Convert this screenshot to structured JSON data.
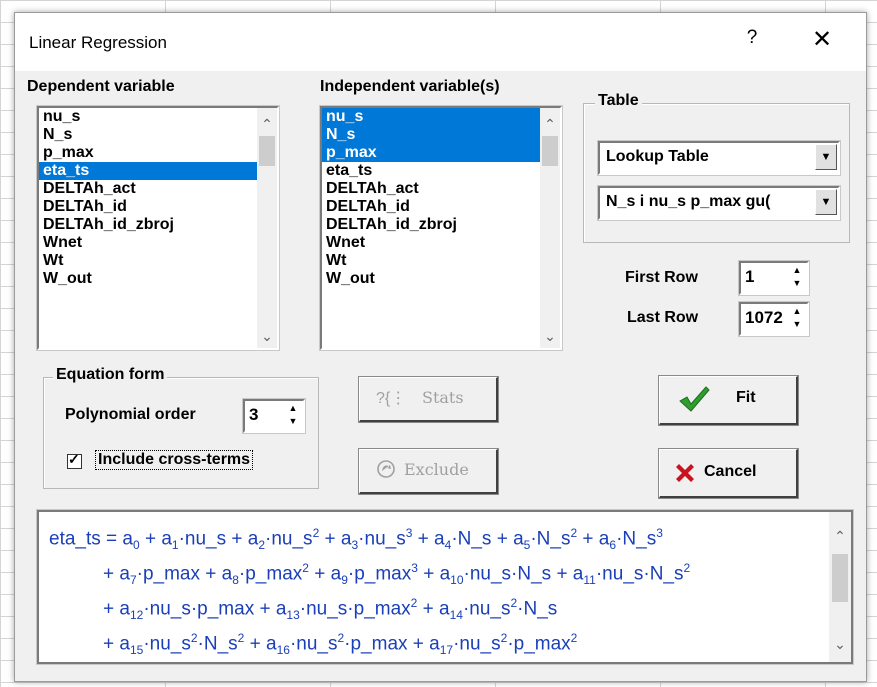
{
  "window": {
    "title": "Linear Regression",
    "help": "?",
    "close": "✕"
  },
  "dependent": {
    "label": "Dependent variable",
    "items": [
      "nu_s",
      "N_s",
      "p_max",
      "eta_ts",
      "DELTAh_act",
      "DELTAh_id",
      "DELTAh_id_zbroj",
      "Wnet",
      "Wt",
      "W_out"
    ],
    "selected": [
      3
    ]
  },
  "independent": {
    "label": "Independent variable(s)",
    "items": [
      "nu_s",
      "N_s",
      "p_max",
      "eta_ts",
      "DELTAh_act",
      "DELTAh_id",
      "DELTAh_id_zbroj",
      "Wnet",
      "Wt",
      "W_out"
    ],
    "selected": [
      0,
      1,
      2
    ]
  },
  "table": {
    "label": "Table",
    "type_value": "Lookup Table",
    "name_value": "N_s i nu_s p_max gu("
  },
  "rows": {
    "first_label": "First Row",
    "first_value": "1",
    "last_label": "Last Row",
    "last_value": "1072"
  },
  "equation_form": {
    "label": "Equation form",
    "poly_label": "Polynomial order",
    "poly_value": "3",
    "cross_label": "Include cross-terms",
    "cross_checked": true
  },
  "buttons": {
    "stats": "Stats",
    "exclude": "Exclude",
    "fit": "Fit",
    "cancel": "Cancel"
  },
  "equation": {
    "line1": [
      [
        "t",
        "eta_ts = a"
      ],
      [
        "sub",
        "0"
      ],
      [
        "t",
        " + a"
      ],
      [
        "sub",
        "1"
      ],
      [
        "t",
        "·nu_s + a"
      ],
      [
        "sub",
        "2"
      ],
      [
        "t",
        "·nu_s"
      ],
      [
        "sup",
        "2"
      ],
      [
        "t",
        " + a"
      ],
      [
        "sub",
        "3"
      ],
      [
        "t",
        "·nu_s"
      ],
      [
        "sup",
        "3"
      ],
      [
        "t",
        " + a"
      ],
      [
        "sub",
        "4"
      ],
      [
        "t",
        "·N_s + a"
      ],
      [
        "sub",
        "5"
      ],
      [
        "t",
        "·N_s"
      ],
      [
        "sup",
        "2"
      ],
      [
        "t",
        " + a"
      ],
      [
        "sub",
        "6"
      ],
      [
        "t",
        "·N_s"
      ],
      [
        "sup",
        "3"
      ]
    ],
    "line2": [
      [
        "t",
        "+ a"
      ],
      [
        "sub",
        "7"
      ],
      [
        "t",
        "·p_max + a"
      ],
      [
        "sub",
        "8"
      ],
      [
        "t",
        "·p_max"
      ],
      [
        "sup",
        "2"
      ],
      [
        "t",
        " + a"
      ],
      [
        "sub",
        "9"
      ],
      [
        "t",
        "·p_max"
      ],
      [
        "sup",
        "3"
      ],
      [
        "t",
        " + a"
      ],
      [
        "sub",
        "10"
      ],
      [
        "t",
        "·nu_s·N_s + a"
      ],
      [
        "sub",
        "11"
      ],
      [
        "t",
        "·nu_s·N_s"
      ],
      [
        "sup",
        "2"
      ]
    ],
    "line3": [
      [
        "t",
        "+ a"
      ],
      [
        "sub",
        "12"
      ],
      [
        "t",
        "·nu_s·p_max + a"
      ],
      [
        "sub",
        "13"
      ],
      [
        "t",
        "·nu_s·p_max"
      ],
      [
        "sup",
        "2"
      ],
      [
        "t",
        " + a"
      ],
      [
        "sub",
        "14"
      ],
      [
        "t",
        "·nu_s"
      ],
      [
        "sup",
        "2"
      ],
      [
        "t",
        "·N_s"
      ]
    ],
    "line4": [
      [
        "t",
        "+ a"
      ],
      [
        "sub",
        "15"
      ],
      [
        "t",
        "·nu_s"
      ],
      [
        "sup",
        "2"
      ],
      [
        "t",
        "·N_s"
      ],
      [
        "sup",
        "2"
      ],
      [
        "t",
        " + a"
      ],
      [
        "sub",
        "16"
      ],
      [
        "t",
        "·nu_s"
      ],
      [
        "sup",
        "2"
      ],
      [
        "t",
        "·p_max + a"
      ],
      [
        "sub",
        "17"
      ],
      [
        "t",
        "·nu_s"
      ],
      [
        "sup",
        "2"
      ],
      [
        "t",
        "·p_max"
      ],
      [
        "sup",
        "2"
      ]
    ]
  },
  "colors": {
    "selection": "#0078d7",
    "equation_text": "#1a3fb8",
    "fit_check": "#2e9e2e",
    "cancel_x": "#c8141e"
  }
}
